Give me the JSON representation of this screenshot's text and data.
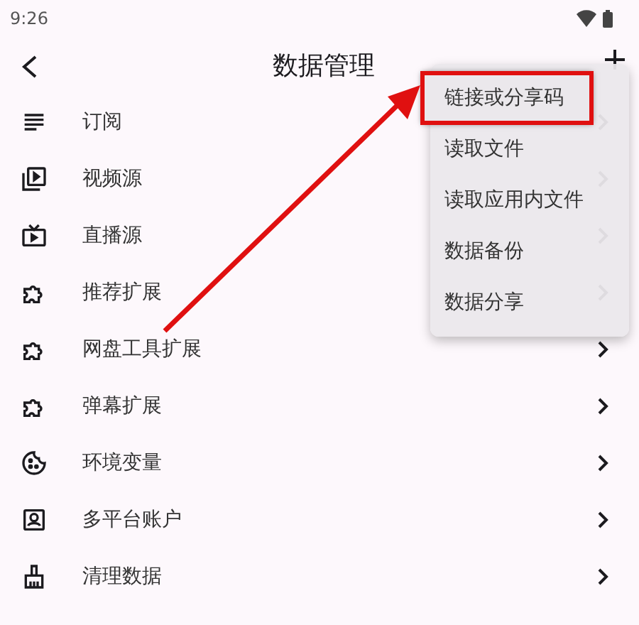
{
  "status_bar": {
    "time": "9:26"
  },
  "app_bar": {
    "title": "数据管理"
  },
  "items": [
    {
      "label": "订阅"
    },
    {
      "label": "视频源"
    },
    {
      "label": "直播源"
    },
    {
      "label": "推荐扩展"
    },
    {
      "label": "网盘工具扩展"
    },
    {
      "label": "弹幕扩展"
    },
    {
      "label": "环境变量"
    },
    {
      "label": "多平台账户"
    },
    {
      "label": "清理数据"
    }
  ],
  "menu": [
    {
      "label": "链接或分享码",
      "highlighted": true
    },
    {
      "label": "读取文件",
      "highlighted": false
    },
    {
      "label": "读取应用内文件",
      "highlighted": false
    },
    {
      "label": "数据备份",
      "highlighted": false
    },
    {
      "label": "数据分享",
      "highlighted": false
    }
  ]
}
